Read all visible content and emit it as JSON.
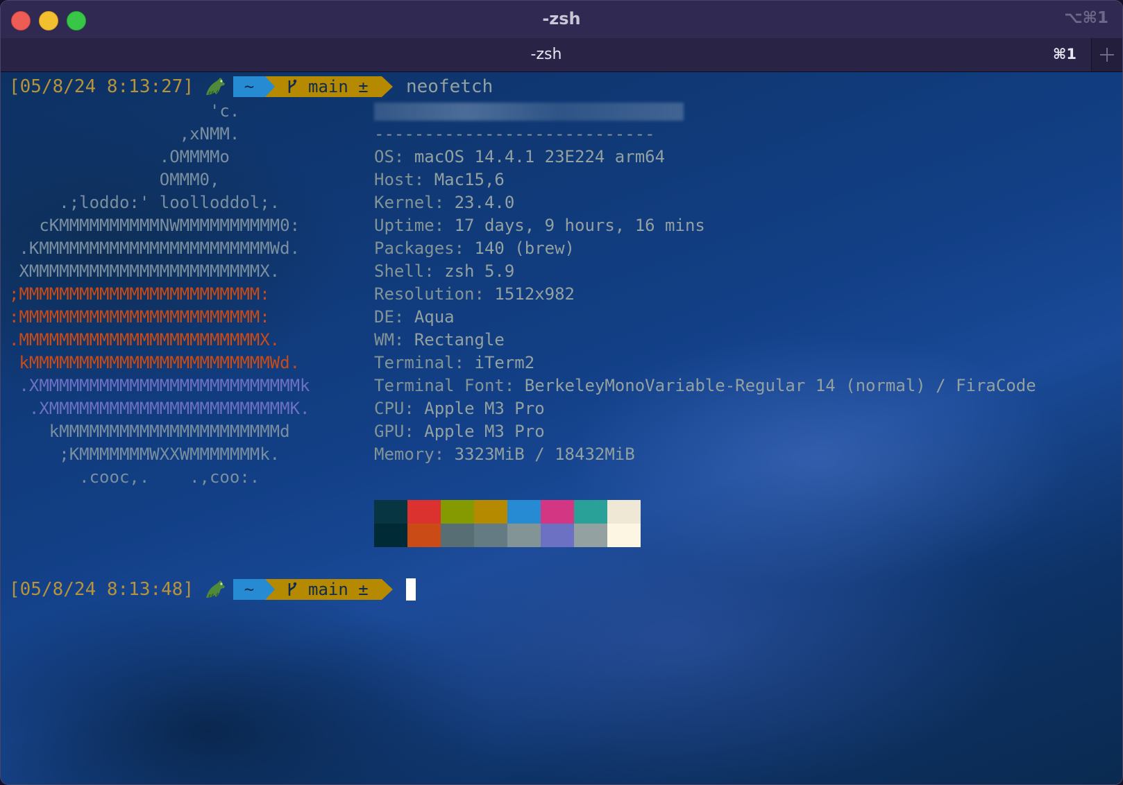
{
  "window": {
    "title": "-zsh",
    "shortcut": "⌥⌘1"
  },
  "tabs": [
    {
      "label": "-zsh",
      "shortcut": "⌘1",
      "active": true
    }
  ],
  "prompt1": {
    "timestamp": "[05/8/24 8:13:27]",
    "dir": "~",
    "git": "main ±",
    "command": "neofetch"
  },
  "prompt2": {
    "timestamp": "[05/8/24 8:13:48]",
    "dir": "~",
    "git": "main ±",
    "command": ""
  },
  "logo_lines": [
    {
      "text": "                    'c.",
      "color": "gray"
    },
    {
      "text": "                 ,xNMM.",
      "color": "gray"
    },
    {
      "text": "               .OMMMMo",
      "color": "gray"
    },
    {
      "text": "               OMMM0,",
      "color": "gray"
    },
    {
      "text": "     .;loddo:' loolloddol;.",
      "color": "gray"
    },
    {
      "text": "   cKMMMMMMMMMMNWMMMMMMMMMM0:",
      "color": "gray"
    },
    {
      "text": " .KMMMMMMMMMMMMMMMMMMMMMMMWd.",
      "color": "gray"
    },
    {
      "text": " XMMMMMMMMMMMMMMMMMMMMMMMX.",
      "color": "gray"
    },
    {
      "text": ";MMMMMMMMMMMMMMMMMMMMMMMM:",
      "color": "orange"
    },
    {
      "text": ":MMMMMMMMMMMMMMMMMMMMMMMM:",
      "color": "orange"
    },
    {
      "text": ".MMMMMMMMMMMMMMMMMMMMMMMMX.",
      "color": "orange"
    },
    {
      "text": " kMMMMMMMMMMMMMMMMMMMMMMMMWd.",
      "color": "orange"
    },
    {
      "text": " .XMMMMMMMMMMMMMMMMMMMMMMMMMMk",
      "color": "violet"
    },
    {
      "text": "  .XMMMMMMMMMMMMMMMMMMMMMMMMK.",
      "color": "violet"
    },
    {
      "text": "    kMMMMMMMMMMMMMMMMMMMMMMd",
      "color": "gray"
    },
    {
      "text": "     ;KMMMMMMMWXXWMMMMMMMk.",
      "color": "gray"
    },
    {
      "text": "       .cooc,.    .,coo:.",
      "color": "gray"
    }
  ],
  "info": {
    "divider": "----------------------------",
    "rows": [
      {
        "key": "OS",
        "value": "macOS 14.4.1 23E224 arm64"
      },
      {
        "key": "Host",
        "value": "Mac15,6"
      },
      {
        "key": "Kernel",
        "value": "23.4.0"
      },
      {
        "key": "Uptime",
        "value": "17 days, 9 hours, 16 mins"
      },
      {
        "key": "Packages",
        "value": "140 (brew)"
      },
      {
        "key": "Shell",
        "value": "zsh 5.9"
      },
      {
        "key": "Resolution",
        "value": "1512x982"
      },
      {
        "key": "DE",
        "value": "Aqua"
      },
      {
        "key": "WM",
        "value": "Rectangle"
      },
      {
        "key": "Terminal",
        "value": "iTerm2"
      },
      {
        "key": "Terminal Font",
        "value": "BerkeleyMonoVariable-Regular 14 (normal) / FiraCode"
      },
      {
        "key": "CPU",
        "value": "Apple M3 Pro"
      },
      {
        "key": "GPU",
        "value": "Apple M3 Pro"
      },
      {
        "key": "Memory",
        "value": "3323MiB / 18432MiB"
      }
    ]
  },
  "palette": {
    "top": [
      "#073642",
      "#dc322f",
      "#859900",
      "#b58900",
      "#268bd2",
      "#d33682",
      "#2aa198",
      "#eee8d5"
    ],
    "bottom": [
      "#002b36",
      "#cb4b16",
      "#586e75",
      "#657b83",
      "#839496",
      "#6c71c4",
      "#93a1a1",
      "#fdf6e3"
    ]
  },
  "colors": {
    "gray": "#7a8fa0",
    "orange": "#cb4b16",
    "violet": "#6c71c4",
    "timestamp": "#b7933a",
    "dir_segment": "#268bd2",
    "git_segment": "#b58900"
  }
}
